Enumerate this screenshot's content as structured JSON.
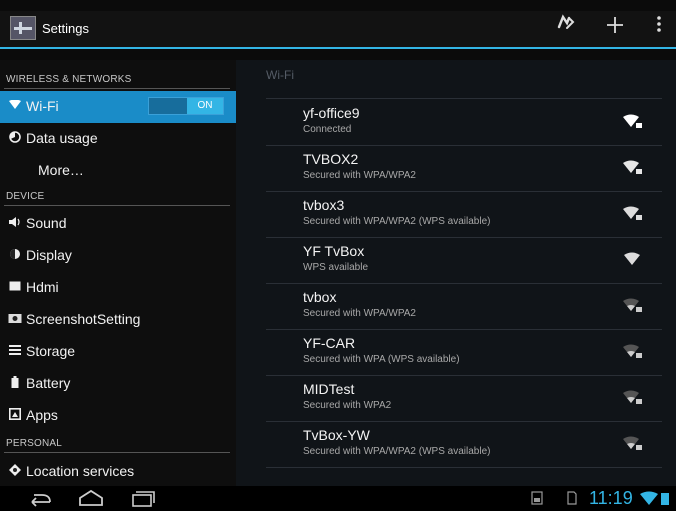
{
  "app": {
    "title": "Settings"
  },
  "action_bar": {
    "icons": [
      "wps-icon",
      "add-icon",
      "overflow-menu-icon"
    ]
  },
  "sidebar": {
    "sections": [
      {
        "header": "WIRELESS & NETWORKS",
        "items": [
          {
            "label": "Wi-Fi",
            "icon": "wifi-icon",
            "toggle": "ON",
            "selected": true
          },
          {
            "label": "Data usage",
            "icon": "data-usage-icon"
          },
          {
            "label": "More…",
            "icon": ""
          }
        ]
      },
      {
        "header": "DEVICE",
        "items": [
          {
            "label": "Sound",
            "icon": "sound-icon"
          },
          {
            "label": "Display",
            "icon": "display-icon"
          },
          {
            "label": "Hdmi",
            "icon": "hdmi-icon"
          },
          {
            "label": "ScreenshotSetting",
            "icon": "camera-icon"
          },
          {
            "label": "Storage",
            "icon": "storage-icon"
          },
          {
            "label": "Battery",
            "icon": "battery-icon"
          },
          {
            "label": "Apps",
            "icon": "apps-icon"
          }
        ]
      },
      {
        "header": "PERSONAL",
        "items": [
          {
            "label": "Location services",
            "icon": "location-icon"
          }
        ]
      }
    ]
  },
  "wifi": {
    "title": "Wi-Fi",
    "networks": [
      {
        "name": "yf-office9",
        "status": "Connected"
      },
      {
        "name": "TVBOX2",
        "status": "Secured with WPA/WPA2"
      },
      {
        "name": "tvbox3",
        "status": "Secured with WPA/WPA2 (WPS available)"
      },
      {
        "name": "YF TvBox",
        "status": "WPS available"
      },
      {
        "name": "tvbox",
        "status": "Secured with WPA/WPA2"
      },
      {
        "name": "YF-CAR",
        "status": "Secured with WPA (WPS available)"
      },
      {
        "name": "MIDTest",
        "status": "Secured with WPA2"
      },
      {
        "name": "TvBox-YW",
        "status": "Secured with WPA/WPA2 (WPS available)"
      }
    ]
  },
  "status_bar": {
    "time": "11:19"
  },
  "colors": {
    "accent": "#33b5e5",
    "selected_row": "#1a8cc8"
  }
}
